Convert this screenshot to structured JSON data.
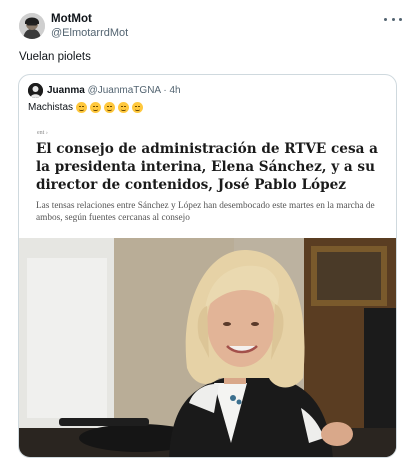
{
  "tweet": {
    "author_name": "MotMot",
    "author_handle": "@ElmotarrdMot",
    "text": "Vuelan piolets"
  },
  "quote": {
    "author_name": "Juanma",
    "author_handle": "@JuanmaTGNA",
    "separator": "·",
    "time": "4h",
    "text": "Machistas",
    "emoji_count": 5,
    "article": {
      "kicker": "ent ›",
      "headline": "El consejo de administración de RTVE cesa a la presidenta interina, Elena Sánchez, y a su director de contenidos, José Pablo López",
      "subheadline": "Las tensas relaciones entre Sánchez y López han desembocado este martes en la marcha de ambos, según fuentes cercanas al consejo"
    }
  },
  "icons": [
    "more-options-icon",
    "thinking-face-emoji"
  ],
  "colors": {
    "text_primary": "#0f1419",
    "text_secondary": "#536471",
    "border": "#cfd9de"
  }
}
